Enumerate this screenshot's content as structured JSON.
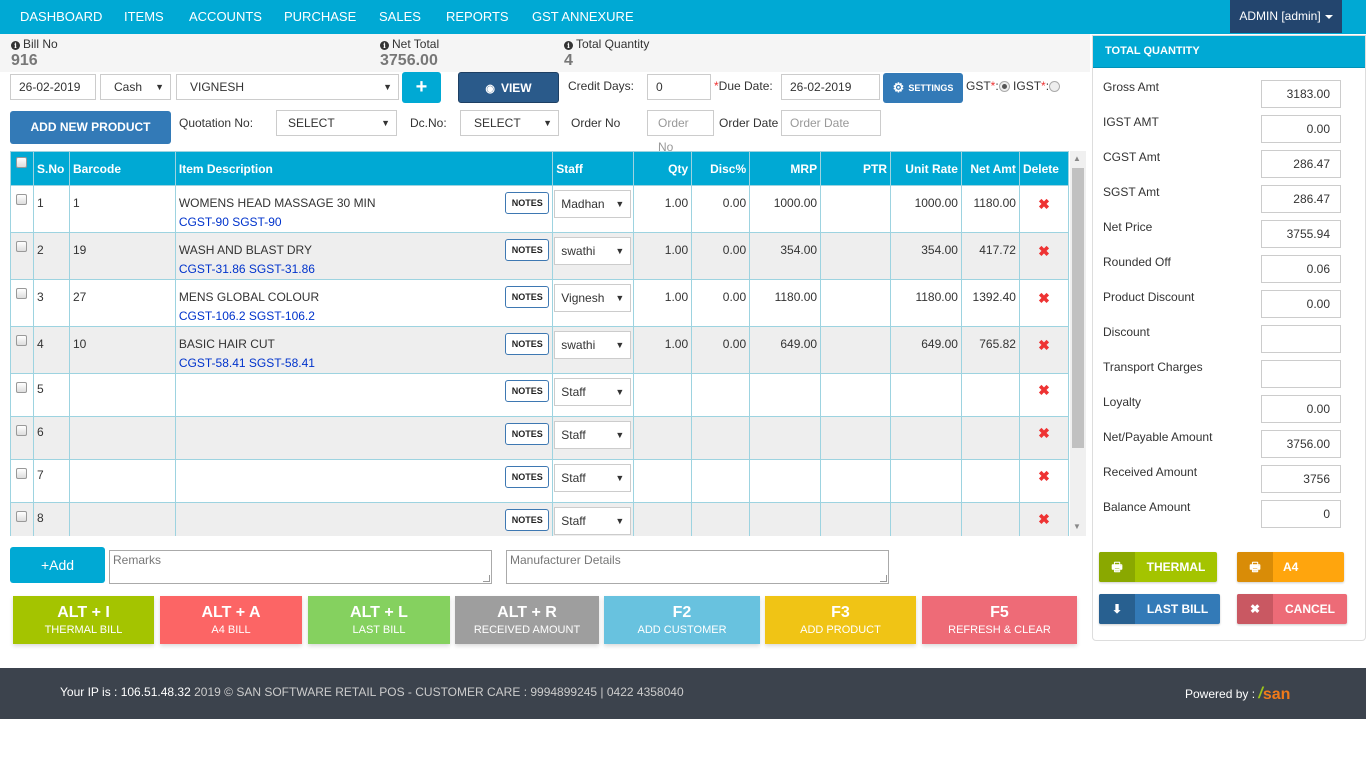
{
  "nav": {
    "items": [
      "DASHBOARD",
      "ITEMS",
      "ACCOUNTS",
      "PURCHASE",
      "SALES",
      "REPORTS",
      "GST ANNEXURE"
    ],
    "user": "ADMIN [admin]"
  },
  "stats": {
    "bill_no_label": "Bill No",
    "bill_no": "916",
    "net_total_label": "Net Total",
    "net_total": "3756.00",
    "total_qty_label": "Total Quantity",
    "total_qty": "4"
  },
  "form": {
    "date": "26-02-2019",
    "payment_mode": "Cash",
    "customer": "VIGNESH",
    "add_customer_symbol": "+",
    "view_label": "VIEW",
    "credit_days_label": "Credit Days:",
    "credit_days": "0",
    "due_date_label": "Due Date:",
    "due_date": "26-02-2019",
    "settings_label": "SETTINGS",
    "gst_label": "GST",
    "igst_label": "IGST",
    "gst_selected": "GST",
    "add_new_product_label": "ADD NEW PRODUCT",
    "quotation_label": "Quotation No:",
    "quotation_value": "SELECT",
    "dc_label": "Dc.No:",
    "dc_value": "SELECT",
    "order_no_label": "Order No",
    "order_no_placeholder": "Order No",
    "order_date_label": "Order Date",
    "order_date_placeholder": "Order Date"
  },
  "table": {
    "headers": [
      "S.No",
      "Barcode",
      "Item Description",
      "Staff",
      "Qty",
      "Disc%",
      "MRP",
      "PTR",
      "Unit Rate",
      "Net Amt",
      "Delete"
    ],
    "notes_label": "NOTES",
    "rows": [
      {
        "sno": "1",
        "barcode": "1",
        "desc": "WOMENS HEAD MASSAGE 30 MIN",
        "gst": "CGST-90  SGST-90",
        "staff": "Madhan",
        "qty": "1.00",
        "disc": "0.00",
        "mrp": "1000.00",
        "ptr": "",
        "unit_rate": "1000.00",
        "net_amt": "1180.00"
      },
      {
        "sno": "2",
        "barcode": "19",
        "desc": "WASH AND BLAST DRY",
        "gst": "CGST-31.86  SGST-31.86",
        "staff": "swathi",
        "qty": "1.00",
        "disc": "0.00",
        "mrp": "354.00",
        "ptr": "",
        "unit_rate": "354.00",
        "net_amt": "417.72"
      },
      {
        "sno": "3",
        "barcode": "27",
        "desc": "MENS GLOBAL COLOUR",
        "gst": "CGST-106.2  SGST-106.2",
        "staff": "Vignesh",
        "qty": "1.00",
        "disc": "0.00",
        "mrp": "1180.00",
        "ptr": "",
        "unit_rate": "1180.00",
        "net_amt": "1392.40"
      },
      {
        "sno": "4",
        "barcode": "10",
        "desc": "BASIC HAIR CUT",
        "gst": "CGST-58.41  SGST-58.41",
        "staff": "swathi",
        "qty": "1.00",
        "disc": "0.00",
        "mrp": "649.00",
        "ptr": "",
        "unit_rate": "649.00",
        "net_amt": "765.82"
      },
      {
        "sno": "5",
        "barcode": "",
        "desc": "",
        "gst": "",
        "staff": "Staff",
        "qty": "",
        "disc": "",
        "mrp": "",
        "ptr": "",
        "unit_rate": "",
        "net_amt": ""
      },
      {
        "sno": "6",
        "barcode": "",
        "desc": "",
        "gst": "",
        "staff": "Staff",
        "qty": "",
        "disc": "",
        "mrp": "",
        "ptr": "",
        "unit_rate": "",
        "net_amt": ""
      },
      {
        "sno": "7",
        "barcode": "",
        "desc": "",
        "gst": "",
        "staff": "Staff",
        "qty": "",
        "disc": "",
        "mrp": "",
        "ptr": "",
        "unit_rate": "",
        "net_amt": ""
      },
      {
        "sno": "8",
        "barcode": "",
        "desc": "",
        "gst": "",
        "staff": "Staff",
        "qty": "",
        "disc": "",
        "mrp": "",
        "ptr": "",
        "unit_rate": "",
        "net_amt": ""
      }
    ]
  },
  "bottom": {
    "add_label": "+Add",
    "remarks_placeholder": "Remarks",
    "manufacturer_placeholder": "Manufacturer Details"
  },
  "shortcuts": [
    {
      "key": "ALT + I",
      "desc": "THERMAL BILL",
      "color": "#a4c400"
    },
    {
      "key": "ALT + A",
      "desc": "A4 BILL",
      "color": "#fc6565"
    },
    {
      "key": "ALT + L",
      "desc": "LAST BILL",
      "color": "#85d15f"
    },
    {
      "key": "ALT + R",
      "desc": "RECEIVED AMOUNT",
      "color": "#9e9e9e"
    },
    {
      "key": "F2",
      "desc": "ADD CUSTOMER",
      "color": "#68c2df"
    },
    {
      "key": "F3",
      "desc": "ADD PRODUCT",
      "color": "#f0c415"
    },
    {
      "key": "F5",
      "desc": "REFRESH & CLEAR",
      "color": "#ee6b77"
    }
  ],
  "panel": {
    "title": "TOTAL QUANTITY",
    "rows": [
      {
        "label": "Gross Amt",
        "value": "3183.00"
      },
      {
        "label": "IGST AMT",
        "value": "0.00"
      },
      {
        "label": "CGST Amt",
        "value": "286.47"
      },
      {
        "label": "SGST Amt",
        "value": "286.47"
      },
      {
        "label": "Net Price",
        "value": "3755.94"
      },
      {
        "label": "Rounded Off",
        "value": "0.06"
      },
      {
        "label": "Product Discount",
        "value": "0.00"
      },
      {
        "label": "Discount",
        "value": ""
      },
      {
        "label": "Transport Charges",
        "value": ""
      },
      {
        "label": "Loyalty",
        "value": "0.00"
      },
      {
        "label": "Net/Payable Amount",
        "value": "3756.00"
      },
      {
        "label": "Received Amount",
        "value": "3756"
      },
      {
        "label": "Balance Amount",
        "value": "0"
      }
    ],
    "buttons": {
      "thermal": "THERMAL",
      "a4": "A4",
      "last_bill": "LAST BILL",
      "cancel": "CANCEL"
    }
  },
  "footer": {
    "ip_label": "Your IP is : 106.51.48.32",
    "copyright": " 2019 © SAN SOFTWARE RETAIL POS - CUSTOMER CARE : 9994899245 | 0422 4358040",
    "powered_by": "Powered by : ",
    "logo_text": "san"
  },
  "colors": {
    "primary": "#00a9d4",
    "dark_blue": "#23456e",
    "button_blue": "#337ab7",
    "delete_red": "#e33333",
    "gst_text": "#0033cc"
  }
}
